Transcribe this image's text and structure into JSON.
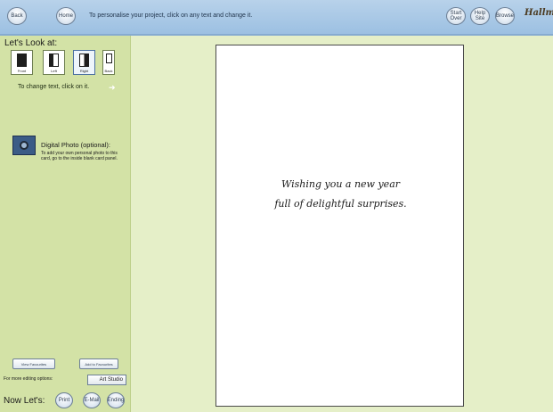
{
  "toolbar": {
    "back_label": "Back",
    "home_label": "Home",
    "hint": "To personalise your project, click on any text and change it.",
    "start_over_label": "Start Over",
    "help_label": "Help Site",
    "browse_label": "Browse",
    "logo": "Hallmark"
  },
  "sidebar": {
    "look_title": "Let's Look at:",
    "views": [
      {
        "label": "Front"
      },
      {
        "label": "Left"
      },
      {
        "label": "Right",
        "active": true
      },
      {
        "label": "Back"
      }
    ],
    "change_text": "To change text, click on it.",
    "digital_photo": {
      "title": "Digital Photo (optional):",
      "text": "To add your own personal photo to this card, go to the inside blank card panel."
    },
    "view_favourites_label": "View Favourites",
    "add_favourites_label": "Add to Favourites",
    "more_options": "For more editing options:",
    "art_studio_label": "Art Studio",
    "now_lets": "Now Let's:",
    "print_label": "Print",
    "email_label": "E-Mail",
    "ending_label": "Ending"
  },
  "card": {
    "line1": "Wishing you a new year",
    "line2": "full of delightful surprises."
  },
  "colors": {
    "toolbar": "#a8c8e6",
    "sidebar": "#d3e2a6",
    "workspace": "#e5efc8",
    "card": "#ffffff"
  }
}
